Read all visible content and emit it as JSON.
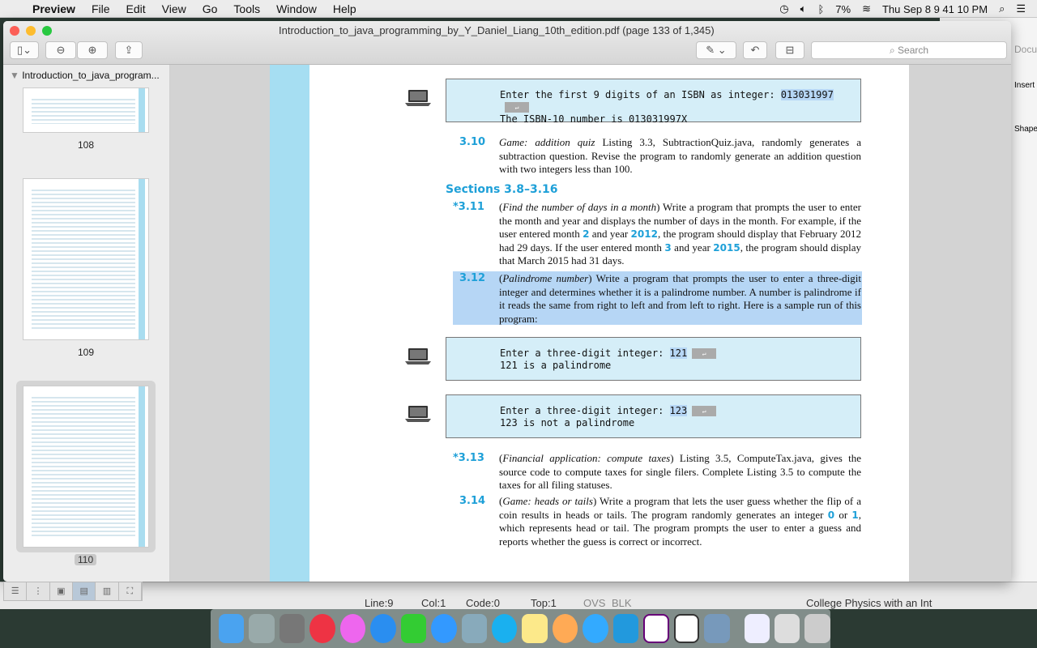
{
  "menubar": {
    "app": "Preview",
    "items": [
      "File",
      "Edit",
      "View",
      "Go",
      "Tools",
      "Window",
      "Help"
    ],
    "status": {
      "battery": "7%",
      "clock": "Thu Sep 8  9 41 10 PM"
    }
  },
  "window": {
    "title": "Introduction_to_java_programming_by_Y_Daniel_Liang_10th_edition.pdf (page 133 of 1,345)",
    "search_placeholder": "Search"
  },
  "sidebar": {
    "document": "Introduction_to_java_program...",
    "pages": [
      "108",
      "109",
      "110"
    ],
    "selected_page": "110"
  },
  "page": {
    "isbn_box": {
      "line1": "Enter the first 9 digits of an ISBN as integer: ",
      "input": "013031997",
      "line2": "The ISBN-10 number is 013031997X"
    },
    "ex310": {
      "num": "3.10",
      "title": "Game: addition quiz",
      "text": " Listing 3.3, SubtractionQuiz.java, randomly generates a subtraction question. Revise the program to randomly generate an addition question with two integers less than 100."
    },
    "section": "Sections 3.8–3.16",
    "ex311": {
      "num": "*3.11",
      "title": "Find the number of days in a month",
      "t1": " Write a program that prompts the user to enter the month and year and displays the number of days in the month. For example, if the user entered month ",
      "v1": "2",
      "t2": " and year ",
      "v2": "2012",
      "t3": ", the program should display that February 2012 had 29 days. If the user entered month ",
      "v3": "3",
      "t4": " and year ",
      "v4": "2015",
      "t5": ", the program should display that March 2015 had 31 days."
    },
    "ex312": {
      "num": "3.12",
      "title": "Palindrome number",
      "text": " Write a program that prompts the user to enter a three-digit integer and determines whether it is a palindrome number. A number is palindrome if it reads the same from right to left and from left to right. Here is a sample run of this program:"
    },
    "run1": {
      "prompt": "Enter a three-digit integer: ",
      "input": "121",
      "output": "121 is a palindrome"
    },
    "run2": {
      "prompt": "Enter a three-digit integer: ",
      "input": "123",
      "output": "123 is not a palindrome"
    },
    "ex313": {
      "num": "*3.13",
      "title": "Financial application: compute taxes",
      "text": " Listing 3.5, ComputeTax.java, gives the source code to compute taxes for single filers. Complete Listing 3.5 to compute the taxes for all filing statuses."
    },
    "ex314": {
      "num": "3.14",
      "title": "Game: heads or tails",
      "t1": " Write a program that lets the user guess whether the flip of a coin results in heads or tails. The program randomly generates an integer ",
      "v1": "0",
      "t2": " or ",
      "v2": "1",
      "t3": ", which represents head or tail. The program prompts the user to enter a guess and reports whether the guess is correct or incorrect."
    }
  },
  "background_app": {
    "search": "Docum",
    "insert": "Insert",
    "shape": "Shape",
    "status": [
      "Line:9",
      "Col:1",
      "Code:0",
      "Top:1",
      "OVS",
      "BLK"
    ],
    "doc_title": "College Physics with an Int"
  },
  "colors": {
    "accent": "#1ea0d8",
    "highlight": "#b6d6f5",
    "code_bg": "#d5eef8"
  }
}
